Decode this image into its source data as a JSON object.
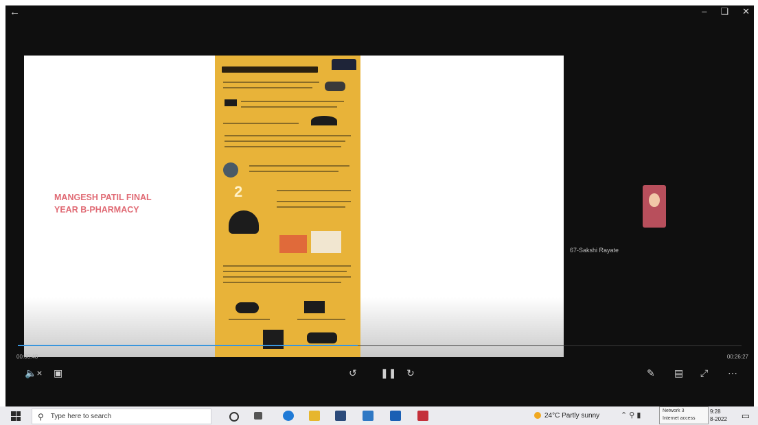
{
  "player": {
    "icons": {
      "back": "back-arrow-icon",
      "minimize": "minimize-icon",
      "restore": "restore-icon",
      "close": "close-icon"
    },
    "slide": {
      "title_line1": "MANGESH PATIL FINAL",
      "title_line2": "YEAR B-PHARMACY",
      "title_color": "#e06a74",
      "poster_color": "#e8b339"
    },
    "participant_name": "67-Sakshi Rayate",
    "time_elapsed": "00:00:48",
    "time_total": "00:26:27",
    "progress": 0.47,
    "accent_color": "#3a96dd"
  },
  "controls": {
    "volume": "mute-volume-icon",
    "captions": "captions-icon",
    "rewind": "rewind-10-icon",
    "pause": "pause-icon",
    "forward": "forward-30-icon",
    "pen": "pen-icon",
    "mini": "mini-view-icon",
    "fullscreen": "fullscreen-icon",
    "more": "more-icon"
  },
  "taskbar": {
    "search_placeholder": "Type here to search",
    "weather_temp": "24°C",
    "weather_text": "Partly sunny",
    "network_tip_line1": "Network 3",
    "network_tip_line2": "Internet access",
    "clock_time": "9:28",
    "clock_date": "8-2022"
  }
}
